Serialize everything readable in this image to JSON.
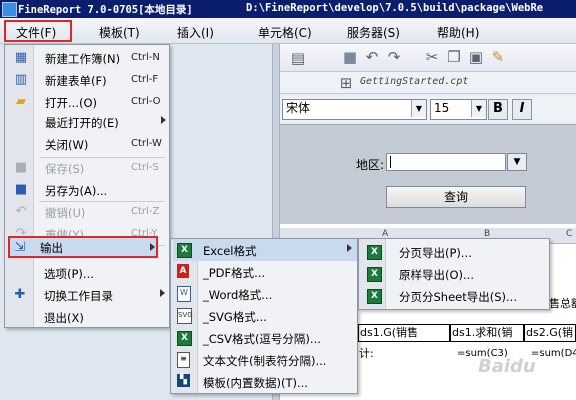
{
  "window": {
    "title_app": "FineReport 7.0-0705[本地目录]",
    "title_path": "D:\\FineReport\\develop\\7.0.5\\build\\package\\WebRe"
  },
  "menubar": {
    "items": [
      "文件(F)",
      "模板(T)",
      "插入(I)",
      "单元格(C)",
      "服务器(S)",
      "帮助(H)"
    ]
  },
  "document": {
    "tab_name": "GettingStarted.cpt"
  },
  "format_bar": {
    "font_name": "宋体",
    "font_size": "15",
    "bold": "B",
    "italic": "I"
  },
  "param_pane": {
    "region_label": "地区:",
    "query_button": "查询"
  },
  "grid": {
    "columns": [
      "A",
      "B",
      "C"
    ],
    "cells": [
      "售总额",
      "ds1.G(销售",
      "ds1.求和(销",
      "ds2.G(销",
      "计:",
      "=sum(C3)",
      "=sum(D4"
    ]
  },
  "file_menu": {
    "items": [
      {
        "label": "新建工作簿(N)",
        "shortcut": "Ctrl-N",
        "icon": "new-workbook-icon"
      },
      {
        "label": "新建表单(F)",
        "shortcut": "Ctrl-F",
        "icon": "new-form-icon"
      },
      {
        "label": "打开...(O)",
        "shortcut": "Ctrl-O",
        "icon": "open-folder-icon"
      },
      {
        "label": "最近打开的(E)",
        "shortcut": "",
        "icon": ""
      },
      {
        "label": "关闭(W)",
        "shortcut": "Ctrl-W",
        "icon": ""
      },
      {
        "label": "保存(S)",
        "shortcut": "Ctrl-S",
        "icon": "save-icon"
      },
      {
        "label": "另存为(A)...",
        "shortcut": "",
        "icon": "save-as-icon"
      },
      {
        "label": "撤销(U)",
        "shortcut": "Ctrl-Z",
        "icon": "undo-icon"
      },
      {
        "label": "重做(Y)",
        "shortcut": "Ctrl-Y",
        "icon": "redo-icon"
      },
      {
        "label": "输出",
        "shortcut": "",
        "icon": "export-icon"
      },
      {
        "label": "选项(P)...",
        "shortcut": "",
        "icon": ""
      },
      {
        "label": "切换工作目录",
        "shortcut": "",
        "icon": "switch-directory-icon"
      },
      {
        "label": "退出(X)",
        "shortcut": "",
        "icon": ""
      }
    ]
  },
  "export_menu": {
    "items": [
      {
        "label": "Excel格式",
        "icon": "excel-icon"
      },
      {
        "label": "_PDF格式...",
        "icon": "pdf-icon"
      },
      {
        "label": "_Word格式...",
        "icon": "word-icon"
      },
      {
        "label": "_SVG格式...",
        "icon": "svg-icon"
      },
      {
        "label": "_CSV格式(逗号分隔)...",
        "icon": "csv-icon"
      },
      {
        "label": "文本文件(制表符分隔)...",
        "icon": "text-file-icon"
      },
      {
        "label": "模板(内置数据)(T)...",
        "icon": "template-icon"
      }
    ]
  },
  "excel_menu": {
    "items": [
      {
        "label": "分页导出(P)...",
        "icon": "excel-icon"
      },
      {
        "label": "原样导出(O)...",
        "icon": "excel-icon"
      },
      {
        "label": "分页分Sheet导出(S)...",
        "icon": "excel-icon"
      }
    ]
  },
  "watermark": "Baidu"
}
